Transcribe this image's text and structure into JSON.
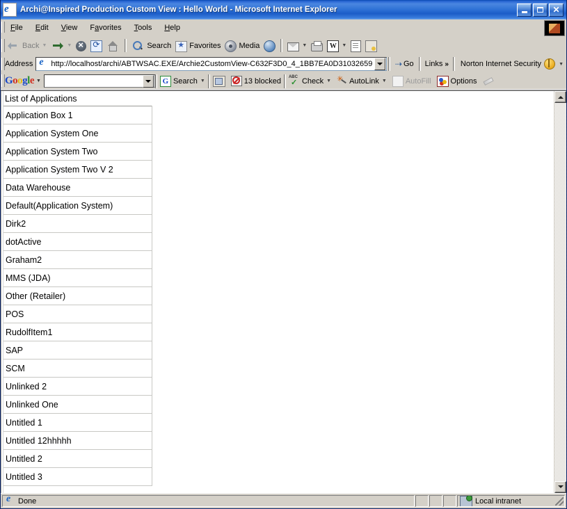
{
  "window": {
    "title": "Archi@Inspired Production Custom View : Hello World - Microsoft Internet Explorer",
    "icon": "ie-document-icon",
    "minimize_label": "_",
    "maximize_label": "□",
    "close_label": "✕"
  },
  "menu": {
    "items": [
      {
        "label": "File",
        "accel": "F"
      },
      {
        "label": "Edit",
        "accel": "E"
      },
      {
        "label": "View",
        "accel": "V"
      },
      {
        "label": "Favorites",
        "accel": "a"
      },
      {
        "label": "Tools",
        "accel": "T"
      },
      {
        "label": "Help",
        "accel": "H"
      }
    ]
  },
  "toolbar": {
    "back_label": "Back",
    "search_label": "Search",
    "favorites_label": "Favorites",
    "media_label": "Media",
    "icons": [
      "back-icon",
      "forward-icon",
      "stop-icon",
      "refresh-icon",
      "home-icon",
      "search-icon",
      "favorites-icon",
      "media-icon",
      "history-icon",
      "mail-icon",
      "print-icon",
      "edit-with-word-icon",
      "discuss-icon",
      "messenger-icon"
    ],
    "word_glyph": "W"
  },
  "address_bar": {
    "label": "Address",
    "url": "http://localhost/archi/ABTWSAC.EXE/Archie2CustomView-C632F3D0_4_1BB7EA0D31032659",
    "go_label": "Go",
    "links_label": "Links",
    "links_chevron": "»",
    "norton_label": "Norton Internet Security"
  },
  "google_toolbar": {
    "logo": {
      "g1": "G",
      "o1": "o",
      "o2": "o",
      "g2": "g",
      "l": "l",
      "e": "e"
    },
    "search_value": "",
    "search_placeholder": "",
    "search_label": "Search",
    "blocked_label": "13 blocked",
    "check_label": "Check",
    "autolink_label": "AutoLink",
    "autofill_label": "AutoFill",
    "options_label": "Options",
    "search_button_glyph": "G"
  },
  "page": {
    "heading": "List of Applications",
    "applications": [
      "Application Box 1",
      "Application System One",
      "Application System Two",
      "Application System Two V 2",
      "Data Warehouse",
      "Default(Application System)",
      "Dirk2",
      "dotActive",
      "Graham2",
      "MMS (JDA)",
      "Other (Retailer)",
      "POS",
      "RudolfItem1",
      "SAP",
      "SCM",
      "Unlinked 2",
      "Unlinked One",
      "Untitled 1",
      "Untitled 12hhhhh",
      "Untitled 2",
      "Untitled 3"
    ]
  },
  "status_bar": {
    "message": "Done",
    "zone": "Local intranet"
  },
  "colors": {
    "titlebar_blue": "#2f72d6",
    "chrome_gray": "#d4d0c8",
    "content_white": "#ffffff",
    "cell_border": "#c8c8c4",
    "google_blue": "#1a48c8",
    "google_red": "#d03020",
    "google_yellow": "#e8b810",
    "google_green": "#2a9030",
    "norton_gold": "#e8a81a"
  }
}
